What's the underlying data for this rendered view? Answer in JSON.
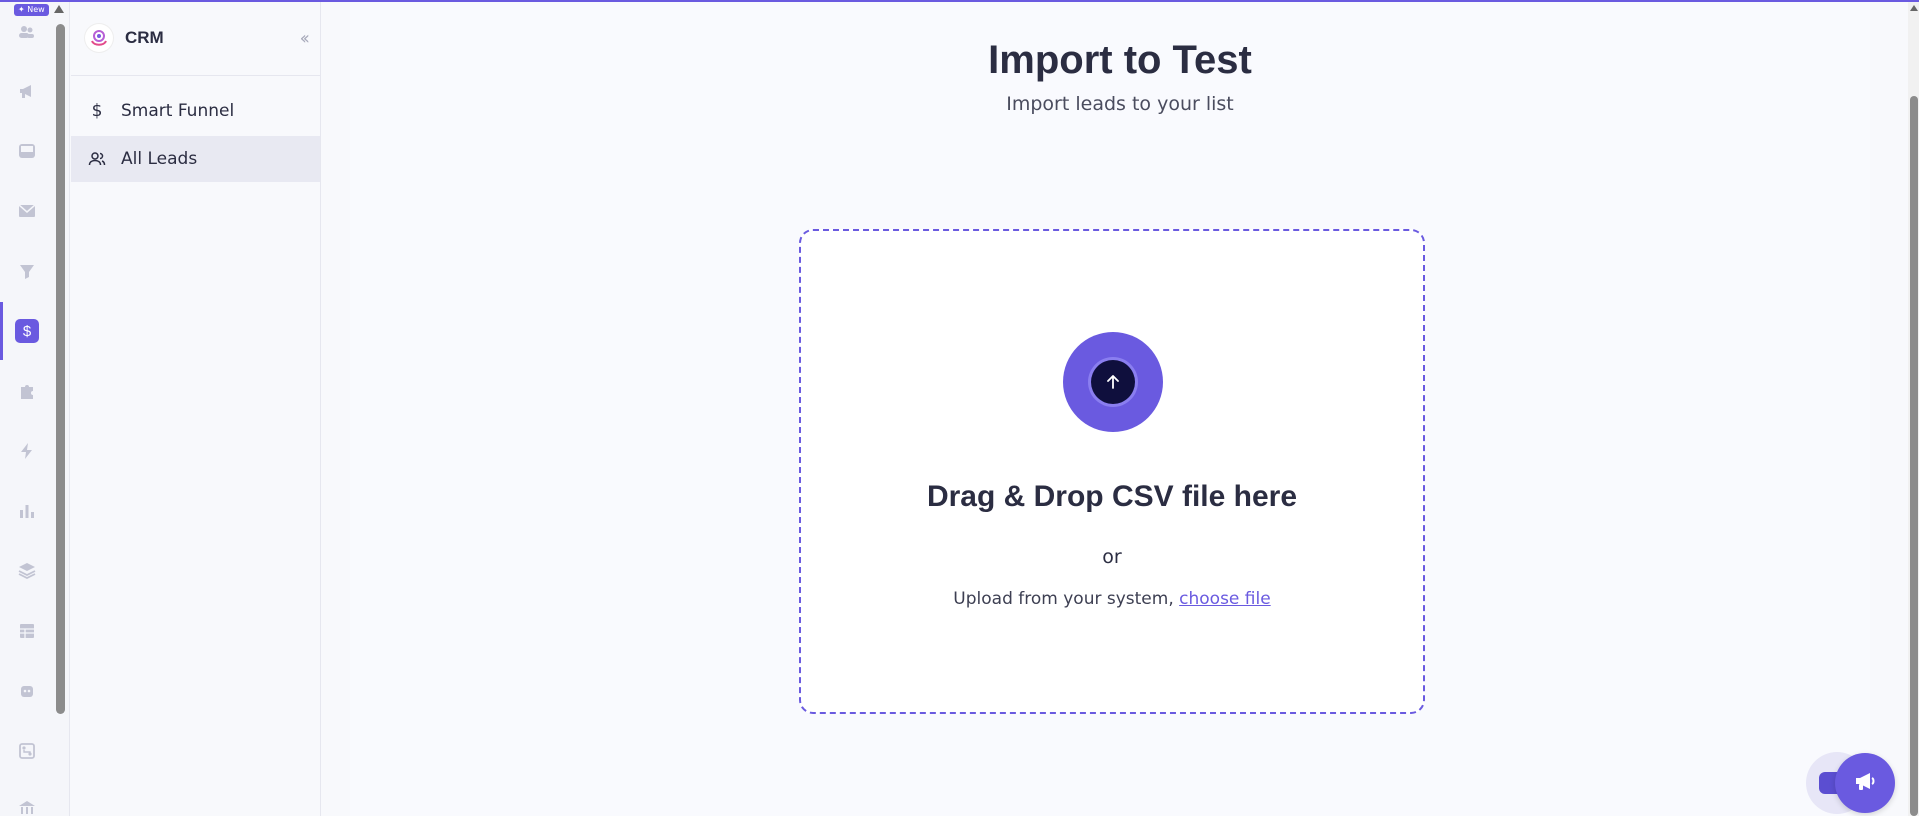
{
  "rail": {
    "badge": "✦ New",
    "active_item": "$"
  },
  "sidebar": {
    "title": "CRM",
    "items": [
      {
        "label": "Smart Funnel",
        "icon": "dollar-icon"
      },
      {
        "label": "All Leads",
        "icon": "users-icon",
        "active": true
      }
    ]
  },
  "main": {
    "title": "Import to Test",
    "subtitle": "Import leads to your list",
    "dropzone": {
      "title": "Drag & Drop CSV file here",
      "or": "or",
      "upload_text": "Upload from your system,",
      "upload_link": "choose file"
    }
  },
  "colors": {
    "accent": "#6a5ae0",
    "text": "#2b2d42",
    "upload_inner": "#0f0f3d"
  }
}
